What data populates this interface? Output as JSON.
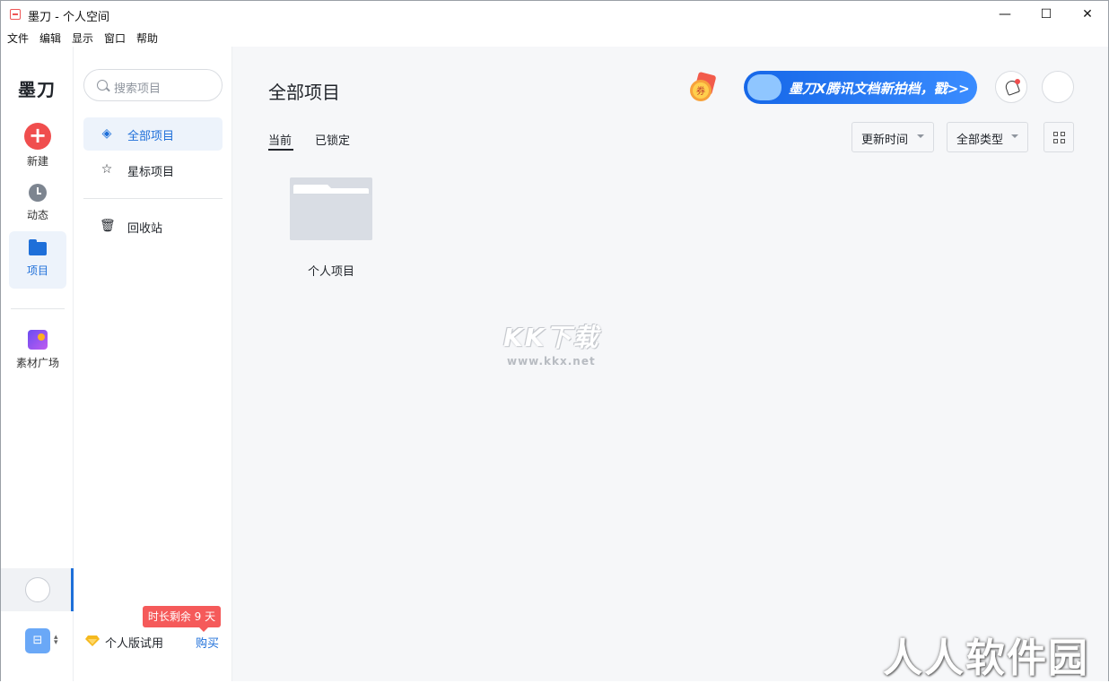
{
  "window": {
    "title": "墨刀 - 个人空间",
    "minimize": "—",
    "maximize": "☐",
    "close": "✕"
  },
  "menu": [
    "文件",
    "编辑",
    "显示",
    "窗口",
    "帮助"
  ],
  "rail": {
    "brand": "墨刀",
    "items": [
      {
        "label": "新建",
        "icon": "plus-icon"
      },
      {
        "label": "动态",
        "icon": "clock-icon"
      },
      {
        "label": "项目",
        "icon": "folder-icon"
      },
      {
        "label": "素材广场",
        "icon": "material-icon"
      }
    ],
    "team_icon_glyph": "⊟"
  },
  "panel": {
    "search_placeholder": "搜索项目",
    "items": [
      {
        "label": "全部项目",
        "icon": "layers-icon",
        "glyph": "◈"
      },
      {
        "label": "星标项目",
        "icon": "star-icon",
        "glyph": "☆"
      },
      {
        "label": "回收站",
        "icon": "trash-icon",
        "glyph": "🗑"
      }
    ],
    "trial_badge": "时长剩余 9 天",
    "trial_text": "个人版试用",
    "buy": "购买"
  },
  "main": {
    "title": "全部项目",
    "coupon": "券",
    "banner": "墨刀X腾讯文档新拍档，戳>>",
    "tabs": [
      "当前",
      "已锁定"
    ],
    "sort_dropdown": "更新时间",
    "type_dropdown": "全部类型",
    "folders": [
      {
        "label": "个人项目"
      }
    ]
  },
  "watermarks": {
    "kkx": "KK下载",
    "kkx_url": "www.kkx.net",
    "rrjy": "人人软件园"
  },
  "colors": {
    "accent": "#1e6fd9",
    "new_button": "#f04e4e",
    "trial_badge": "#f55a5a"
  }
}
